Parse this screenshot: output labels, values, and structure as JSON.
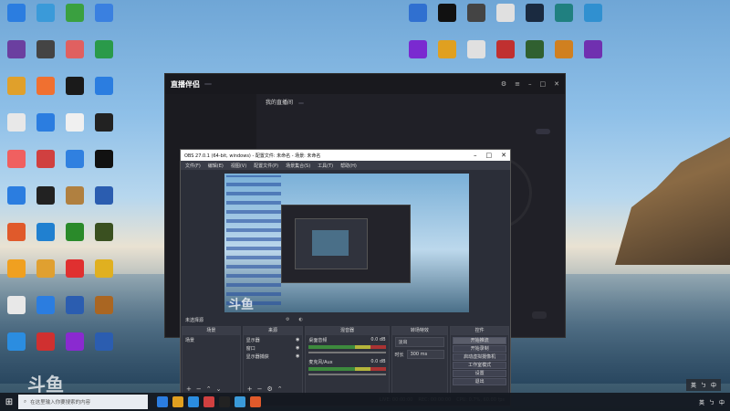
{
  "desktop": {
    "left_icons": [
      {
        "label": "",
        "color": "#2b7de0"
      },
      {
        "label": "",
        "color": "#6b3fa0"
      },
      {
        "label": "",
        "color": "#e0a02b"
      },
      {
        "label": "",
        "color": "#e8e8e8"
      },
      {
        "label": "",
        "color": "#f06060"
      },
      {
        "label": "",
        "color": "#2b7de0"
      },
      {
        "label": "",
        "color": "#e05a2b"
      },
      {
        "label": "",
        "color": "#f0a020"
      },
      {
        "label": "",
        "color": "#e8e8e8"
      },
      {
        "label": "",
        "color": "#2b8de0"
      },
      {
        "label": "",
        "color": "#3a9ad9"
      },
      {
        "label": "",
        "color": "#444444"
      },
      {
        "label": "",
        "color": "#f07030"
      },
      {
        "label": "",
        "color": "#2b7de0"
      },
      {
        "label": "",
        "color": "#d04040"
      },
      {
        "label": "",
        "color": "#222222"
      },
      {
        "label": "",
        "color": "#2080d0"
      },
      {
        "label": "",
        "color": "#e0a030"
      },
      {
        "label": "",
        "color": "#2b7de0"
      },
      {
        "label": "",
        "color": "#d03030"
      },
      {
        "label": "",
        "color": "#3aa040"
      },
      {
        "label": "",
        "color": "#e06060"
      },
      {
        "label": "",
        "color": "#1a1a1a"
      },
      {
        "label": "",
        "color": "#f0f0f0"
      },
      {
        "label": "",
        "color": "#3080e0"
      },
      {
        "label": "",
        "color": "#b08040"
      },
      {
        "label": "",
        "color": "#2a8a2a"
      },
      {
        "label": "",
        "color": "#e03030"
      },
      {
        "label": "",
        "color": "#2b5db0"
      },
      {
        "label": "",
        "color": "#8a2ad0"
      },
      {
        "label": "",
        "color": "#3a80e0"
      },
      {
        "label": "",
        "color": "#2a9a4a"
      },
      {
        "label": "",
        "color": "#2b7de0"
      },
      {
        "label": "",
        "color": "#222222"
      },
      {
        "label": "",
        "color": "#111111"
      },
      {
        "label": "",
        "color": "#2b5db0"
      },
      {
        "label": "",
        "color": "#3a5020"
      },
      {
        "label": "",
        "color": "#e0b020"
      },
      {
        "label": "",
        "color": "#aa6622"
      },
      {
        "label": "",
        "color": "#2b5db0"
      }
    ],
    "right_icons": [
      {
        "label": "",
        "color": "#3070d0"
      },
      {
        "label": "",
        "color": "#111111"
      },
      {
        "label": "",
        "color": "#444444"
      },
      {
        "label": "",
        "color": "#e0e0e0"
      },
      {
        "label": "",
        "color": "#1a2a40"
      },
      {
        "label": "",
        "color": "#208080"
      },
      {
        "label": "",
        "color": "#3090d0"
      },
      {
        "label": "",
        "color": "#7a2ad0"
      },
      {
        "label": "",
        "color": "#e0a020"
      },
      {
        "label": "",
        "color": "#e0e0e0"
      },
      {
        "label": "",
        "color": "#c03030"
      },
      {
        "label": "",
        "color": "#306030"
      },
      {
        "label": "",
        "color": "#d08020"
      },
      {
        "label": "",
        "color": "#7030b0"
      }
    ]
  },
  "zb_window": {
    "logo": "直播伴侣",
    "badge": "",
    "title_text": "直播伴侣",
    "stream_title": "我的直播间",
    "tag": "",
    "meta": "",
    "mode_label": "",
    "exit_label": "",
    "rec_label": ""
  },
  "obs": {
    "window_title": "OBS 27.0.1 (64-bit, windows) - 配置文件: 未命名 - 场景: 未命名",
    "menu": [
      "文件(F)",
      "编辑(E)",
      "视图(V)",
      "配置文件(P)",
      "场景集合(S)",
      "工具(T)",
      "帮助(H)"
    ],
    "scene_label": "未选择源",
    "strip_buttons": [
      "",
      ""
    ],
    "docks": {
      "scenes_header": "场景",
      "scenes": [
        "场景"
      ],
      "sources_header": "来源",
      "sources": [
        "显示器",
        "窗口",
        "显示器捕获"
      ],
      "mixer_header": "混音器",
      "mixer": [
        {
          "name": "桌面音频",
          "level": "0.0 dB"
        },
        {
          "name": "麦克风/Aux",
          "level": "0.0 dB"
        }
      ],
      "transitions_header": "转场特效",
      "transition_value": "淡出",
      "duration_label": "时长",
      "duration_value": "300 ms",
      "controls_header": "控件",
      "controls": [
        "开始推流",
        "开始录制",
        "启动虚拟摄像机",
        "工作室模式",
        "设置",
        "退出"
      ]
    },
    "status": [
      "LIVE: 00:00:00",
      "REC: 00:00:00",
      "CPU: 0.7%, 60.00 fps"
    ]
  },
  "taskbar": {
    "start_glyph": "⊞",
    "search_placeholder": "在这里输入你要搜索的内容",
    "apps": [
      "#2b7de0",
      "#e0a020",
      "#2b8de0",
      "#d04040",
      "#222222",
      "#3a9ad9",
      "#e05a2b"
    ],
    "tray": [
      "英",
      "ㄅ",
      "中"
    ],
    "ime": [
      "英",
      "ㄅ",
      "中"
    ]
  },
  "watermark": "斗鱼",
  "watermark2": "斗鱼"
}
